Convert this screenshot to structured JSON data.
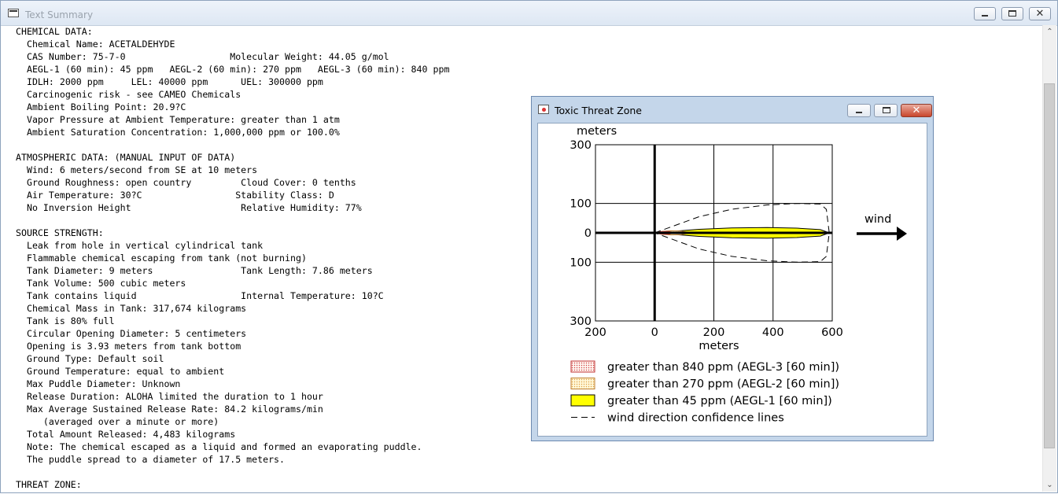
{
  "window": {
    "title": "Text Summary",
    "minimize_label": "",
    "maximize_label": "",
    "close_label": "✕"
  },
  "summary": {
    "lines": [
      "CHEMICAL DATA:",
      "  Chemical Name: ACETALDEHYDE",
      "  CAS Number: 75-7-0                   Molecular Weight: 44.05 g/mol",
      "  AEGL-1 (60 min): 45 ppm   AEGL-2 (60 min): 270 ppm   AEGL-3 (60 min): 840 ppm",
      "  IDLH: 2000 ppm     LEL: 40000 ppm      UEL: 300000 ppm",
      "  Carcinogenic risk - see CAMEO Chemicals",
      "  Ambient Boiling Point: 20.9?C",
      "  Vapor Pressure at Ambient Temperature: greater than 1 atm",
      "  Ambient Saturation Concentration: 1,000,000 ppm or 100.0%",
      "",
      "ATMOSPHERIC DATA: (MANUAL INPUT OF DATA)",
      "  Wind: 6 meters/second from SE at 10 meters",
      "  Ground Roughness: open country         Cloud Cover: 0 tenths",
      "  Air Temperature: 30?C                 Stability Class: D",
      "  No Inversion Height                    Relative Humidity: 77%",
      "",
      "SOURCE STRENGTH:",
      "  Leak from hole in vertical cylindrical tank",
      "  Flammable chemical escaping from tank (not burning)",
      "  Tank Diameter: 9 meters                Tank Length: 7.86 meters",
      "  Tank Volume: 500 cubic meters",
      "  Tank contains liquid                   Internal Temperature: 10?C",
      "  Chemical Mass in Tank: 317,674 kilograms",
      "  Tank is 80% full",
      "  Circular Opening Diameter: 5 centimeters",
      "  Opening is 3.93 meters from tank bottom",
      "  Ground Type: Default soil",
      "  Ground Temperature: equal to ambient",
      "  Max Puddle Diameter: Unknown",
      "  Release Duration: ALOHA limited the duration to 1 hour",
      "  Max Average Sustained Release Rate: 84.2 kilograms/min",
      "     (averaged over a minute or more)",
      "  Total Amount Released: 4,483 kilograms",
      "  Note: The chemical escaped as a liquid and formed an evaporating puddle.",
      "  The puddle spread to a diameter of 17.5 meters.",
      "",
      "THREAT ZONE:"
    ]
  },
  "threat_window": {
    "title": "Toxic Threat Zone",
    "close_label": "✕",
    "wind_label": "wind"
  },
  "chart_data": {
    "type": "area",
    "xlabel": "meters",
    "ylabel": "meters",
    "xlim": [
      -200,
      600
    ],
    "ylim": [
      -300,
      300
    ],
    "x_ticks": [
      -200,
      0,
      200,
      400,
      600
    ],
    "x_tick_labels": [
      "200",
      "0",
      "200",
      "400",
      "600"
    ],
    "y_ticks": [
      300,
      100,
      0,
      -100,
      -300
    ],
    "y_tick_labels": [
      "300",
      "100",
      "0",
      "100",
      "300"
    ],
    "grid": true,
    "legend_position": "bottom",
    "legend": [
      {
        "label": "greater than 840 ppm (AEGL-3 [60 min])",
        "color": "#d04040",
        "pattern": "dots"
      },
      {
        "label": "greater than 270 ppm (AEGL-2 [60 min])",
        "color": "#e8b060",
        "pattern": "dots"
      },
      {
        "label": "greater than 45 ppm (AEGL-1 [60 min])",
        "color": "#ffff00",
        "pattern": "solid"
      },
      {
        "label": "wind direction confidence lines",
        "color": "#000000",
        "pattern": "dashed"
      }
    ],
    "series": [
      {
        "name": "greater than 45 ppm (AEGL-1 [60 min])",
        "x": [
          0,
          60,
          150,
          260,
          380,
          480,
          560,
          590
        ],
        "half_width": [
          0,
          5,
          12,
          17,
          18,
          16,
          11,
          0
        ]
      },
      {
        "name": "greater than 270 ppm (AEGL-2 [60 min])",
        "x": [
          0,
          25,
          55,
          90,
          120
        ],
        "half_width": [
          0,
          5,
          7,
          6,
          0
        ]
      },
      {
        "name": "greater than 840 ppm (AEGL-3 [60 min])",
        "x": [
          0,
          20,
          45,
          70
        ],
        "half_width": [
          0,
          4,
          5,
          0
        ]
      }
    ],
    "confidence_lines": {
      "x": [
        0,
        60,
        150,
        260,
        380,
        480,
        560,
        580,
        590
      ],
      "half_width": [
        0,
        22,
        55,
        80,
        95,
        100,
        98,
        80,
        0
      ]
    }
  }
}
